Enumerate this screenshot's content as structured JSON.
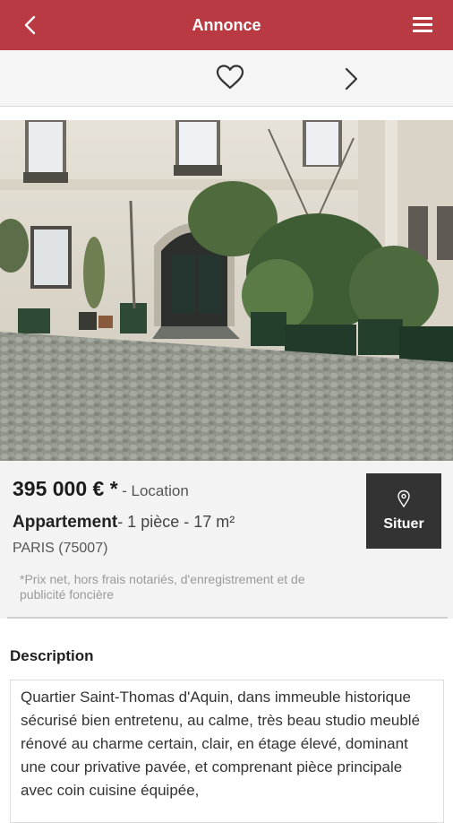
{
  "app_bar": {
    "title": "Annonce"
  },
  "listing": {
    "price": "395 000 € *",
    "transaction": "- Location",
    "type": "Appartement",
    "details": "- 1 pièce - 17 m²",
    "city": "PARIS (75007)",
    "price_note": "*Prix net, hors frais notariés, d'enregistrement et de publicité foncière",
    "locate_label": "Situer"
  },
  "description": {
    "title": "Description",
    "text": "Quartier Saint-Thomas d'Aquin, dans immeuble historique sécurisé bien entretenu, au calme, très beau studio meublé rénové au charme certain, clair, en étage élevé, dominant une cour privative pavée, et comprenant pièce principale avec coin cuisine équipée,"
  },
  "colors": {
    "brand": "#b93a42",
    "locate_button": "#333333"
  }
}
